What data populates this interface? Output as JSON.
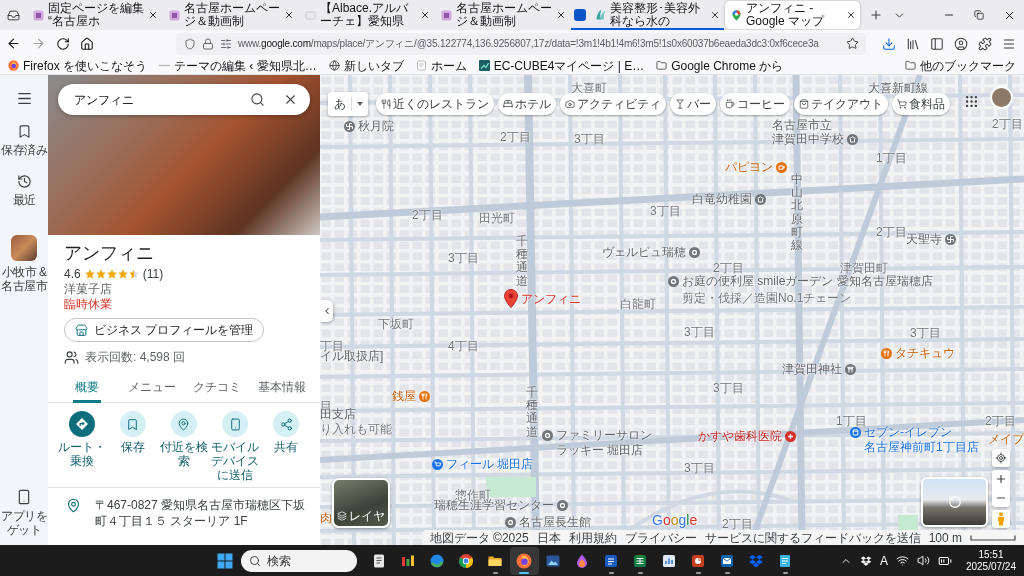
{
  "browser": {
    "tabs": [
      {
        "title": "固定ページを編集 “名古屋ホ",
        "selected": false,
        "grouped": false
      },
      {
        "title": "名古屋ホームページ＆動画制",
        "selected": false,
        "grouped": false
      },
      {
        "title": "【Albace.アルバーチェ】愛知県",
        "selected": false,
        "grouped": false
      },
      {
        "title": "名古屋ホームページ＆動画制",
        "selected": false,
        "grouped": false
      },
      {
        "title": "美容整形･美容外科なら水の",
        "selected": false,
        "grouped": true
      },
      {
        "title": "アンフィニ - Google マップ",
        "selected": true,
        "grouped": false
      }
    ],
    "url_parts": [
      "www.",
      "google.com",
      "/maps/place/アンフィニ/@35.122774,136.9256807,17z/data=!3m1!4b1!4m6!3m5!1s0x60037b6eaeda3dc3:0xf6cece3a"
    ],
    "bookmarks": [
      "Firefox を使いこなそう",
      "テーマの編集 ‹ 愛知県北…",
      "新しいタブ",
      "ホーム",
      "EC-CUBE4マイページ | E…",
      "Google Chrome から"
    ],
    "other_bookmarks": "他のブックマーク"
  },
  "maps": {
    "rail": [
      "保存済み",
      "最近",
      "小牧市 & 名古屋市"
    ],
    "rail_bottom": "アプリをゲット",
    "search": {
      "value": "アンフィニ"
    },
    "place": {
      "name": "アンフィニ",
      "rating": "4.6",
      "stars": 4.5,
      "review_count": "(11)",
      "category": "洋菓子店",
      "status": "臨時休業",
      "manage_button": "ビジネス プロフィールを管理",
      "views": "表示回数: 4,598 回"
    },
    "tabs": [
      {
        "label": "概要",
        "selected": true
      },
      {
        "label": "メニュー",
        "selected": false
      },
      {
        "label": "クチコミ",
        "selected": false
      },
      {
        "label": "基本情報",
        "selected": false
      }
    ],
    "actions": [
      {
        "label": "ルート・乗換",
        "primary": true
      },
      {
        "label": "保存",
        "primary": false
      },
      {
        "label": "付近を検索",
        "primary": false
      },
      {
        "label": "モバイルデバイスに送信",
        "primary": false
      },
      {
        "label": "共有",
        "primary": false
      }
    ],
    "address": "〒467-0827 愛知県名古屋市瑞穂区下坂町４丁目１５ スターリア 1F",
    "map": {
      "input_tool": "あ",
      "chips": [
        "近くのレストラン",
        "ホテル",
        "アクティビティ",
        "バー",
        "コーヒー",
        "テイクアウト",
        "食料品"
      ],
      "areas": [
        "大喜町",
        "2丁目",
        "2丁目",
        "3丁目",
        "1丁目",
        "2丁目",
        "田光町",
        "3丁目",
        "2丁目",
        "3丁目",
        "2丁目",
        "津賀田町",
        "白龍町",
        "下坂町",
        "3丁目",
        "3丁目",
        "丁目",
        "4丁目",
        "3丁目",
        "目",
        "1丁目",
        "2丁目",
        "3丁目",
        "惣作町",
        "2丁目"
      ],
      "roads": [
        {
          "text": "大喜新町線",
          "kind": "horizontal"
        },
        {
          "text": "中山北原町線",
          "kind": "vertical"
        },
        {
          "text": "千種通道",
          "kind": "vertical"
        },
        {
          "text": "千種通道",
          "kind": "vertical"
        }
      ],
      "places": [
        {
          "text": "秋月院",
          "kind": "temple"
        },
        {
          "text": "名古屋市立",
          "kind": "place"
        },
        {
          "text": "津賀田中学校",
          "kind": "school"
        },
        {
          "text": "パピヨン",
          "kind": "cafe"
        },
        {
          "text": "白竜幼稚園",
          "kind": "school"
        },
        {
          "text": "天聖寺",
          "kind": "temple"
        },
        {
          "text": "ヴェルビュ瑞穂",
          "kind": "place"
        },
        {
          "text": "お庭の便利屋 smileガーデン 愛知名古屋瑞穂店",
          "kind": "place"
        },
        {
          "text": "アンフィニ",
          "kind": "pin"
        },
        {
          "text": "剪定・伐採／造園No.1チェーン",
          "kind": "note"
        },
        {
          "text": "イル取扱店]",
          "kind": "place"
        },
        {
          "text": "タチキュウ",
          "kind": "food"
        },
        {
          "text": "津賀田神社",
          "kind": "shrine"
        },
        {
          "text": "銭屋",
          "kind": "food"
        },
        {
          "text": "田支店",
          "kind": "place"
        },
        {
          "text": "り入れも可能",
          "kind": "note"
        },
        {
          "text": "ファミリーサロン",
          "kind": "place"
        },
        {
          "text": "かすや歯科医院",
          "kind": "clinic"
        },
        {
          "text": "セブン-イレブン",
          "kind": "store"
        },
        {
          "text": "ラッキー 堀田店",
          "kind": "place"
        },
        {
          "text": "名古屋神前町1丁目店",
          "kind": "store"
        },
        {
          "text": "メイプ",
          "kind": "food"
        },
        {
          "text": "フィール 堀田店",
          "kind": "shop"
        },
        {
          "text": "瑞穂生涯学習センター",
          "kind": "place"
        },
        {
          "text": "肉",
          "kind": "food"
        },
        {
          "text": "名古屋長生館",
          "kind": "place"
        }
      ],
      "layers": "レイヤ",
      "logo": "Google",
      "attribution": [
        "地図データ ©2025",
        "日本",
        "利用規約",
        "プライバシー",
        "サービスに関するフィードバックを送信"
      ],
      "scale": "100 m"
    }
  },
  "taskbar": {
    "search": {
      "placeholder": "検索"
    },
    "apps": [
      {
        "running": false,
        "selected": false
      },
      {
        "running": false,
        "selected": false
      },
      {
        "running": false,
        "selected": false
      },
      {
        "running": false,
        "selected": false
      },
      {
        "running": true,
        "selected": false
      },
      {
        "running": true,
        "selected": true
      },
      {
        "running": false,
        "selected": false
      },
      {
        "running": false,
        "selected": false
      },
      {
        "running": true,
        "selected": false
      },
      {
        "running": true,
        "selected": false
      },
      {
        "running": false,
        "selected": false
      },
      {
        "running": true,
        "selected": false
      },
      {
        "running": true,
        "selected": false
      },
      {
        "running": false,
        "selected": false
      },
      {
        "running": true,
        "selected": false
      }
    ],
    "ime": "A",
    "time": "15:51",
    "date": "2025/07/24"
  }
}
